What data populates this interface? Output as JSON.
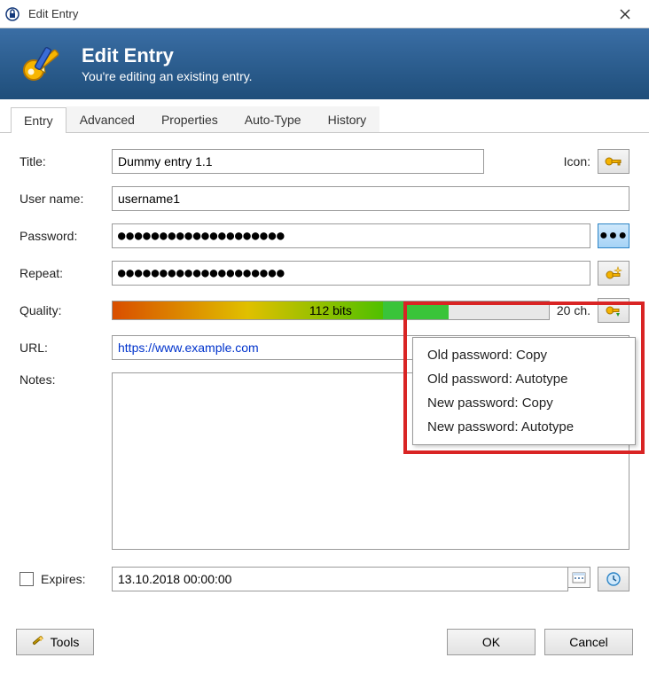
{
  "window": {
    "title": "Edit Entry"
  },
  "header": {
    "title": "Edit Entry",
    "subtitle": "You're editing an existing entry."
  },
  "tabs": [
    "Entry",
    "Advanced",
    "Properties",
    "Auto-Type",
    "History"
  ],
  "active_tab": 0,
  "form": {
    "title_label": "Title:",
    "title_value": "Dummy entry 1.1",
    "icon_label": "Icon:",
    "username_label": "User name:",
    "username_value": "username1",
    "password_label": "Password:",
    "password_value": "●●●●●●●●●●●●●●●●●●●●",
    "repeat_label": "Repeat:",
    "repeat_value": "●●●●●●●●●●●●●●●●●●●●",
    "quality_label": "Quality:",
    "quality_text": "112 bits",
    "quality_chars": "20 ch.",
    "url_label": "URL:",
    "url_value": "https://www.example.com",
    "notes_label": "Notes:",
    "expires_label": "Expires:",
    "expires_value": "13.10.2018 00:00:00"
  },
  "popup_items": [
    "Old password: Copy",
    "Old password: Autotype",
    "New password: Copy",
    "New password: Autotype"
  ],
  "buttons": {
    "tools": "Tools",
    "ok": "OK",
    "cancel": "Cancel"
  }
}
